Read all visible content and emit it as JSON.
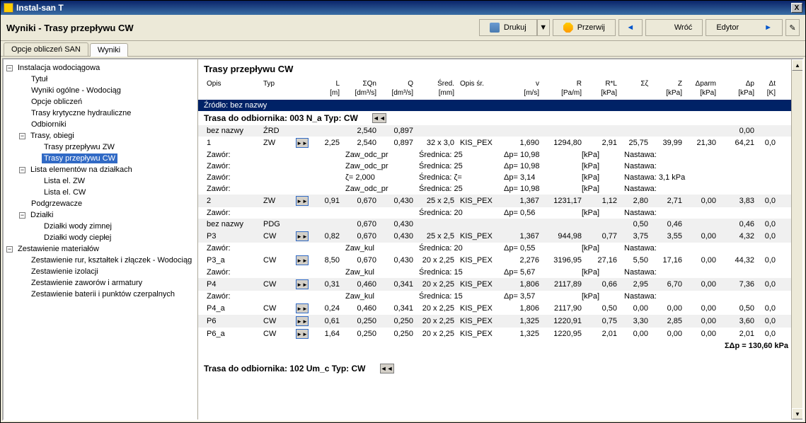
{
  "window": {
    "title": "Instal-san T",
    "close": "X"
  },
  "toolbar": {
    "page_title": "Wyniki - Trasy przepływu CW",
    "print": "Drukuj",
    "stop": "Przerwij",
    "back": "Wróć",
    "editor": "Edytor"
  },
  "tabs": {
    "tab1": "Opcje obliczeń SAN",
    "tab2": "Wyniki"
  },
  "tree": {
    "root1": "Instalacja wodociągowa",
    "n1": "Tytuł",
    "n2": "Wyniki ogólne - Wodociąg",
    "n3": "Opcje obliczeń",
    "n4": "Trasy krytyczne hydrauliczne",
    "n5": "Odbiorniki",
    "n6": "Trasy, obiegi",
    "n6a": "Trasy przepływu ZW",
    "n6b": "Trasy przepływu CW",
    "n7": "Lista elementów na działkach",
    "n7a": "Lista el. ZW",
    "n7b": "Lista el. CW",
    "n8": "Podgrzewacze",
    "n9": "Działki",
    "n9a": "Działki wody zimnej",
    "n9b": "Działki wody ciepłej",
    "root2": "Zestawienie materiałów",
    "m1": "Zestawienie rur, kształtek i złączek - Wodociąg",
    "m2": "Zestawienie izolacji",
    "m3": "Zestawienie zaworów i armatury",
    "m4": "Zestawienie baterii i punktów czerpalnych"
  },
  "panel": {
    "title": "Trasy przepływu CW",
    "headers": {
      "opis": "Opis",
      "typ": "Typ",
      "l": "L",
      "sqn": "ΣQn",
      "q": "Q",
      "sred": "Śred.",
      "opissr": "Opis śr.",
      "v": "v",
      "r": "R",
      "rl": "R*L",
      "sz": "Σζ",
      "z": "Z",
      "darm": "Δparm",
      "dp": "Δp",
      "dk": "Δt"
    },
    "units": {
      "l": "[m]",
      "sqn": "[dm³/s]",
      "q": "[dm³/s]",
      "sred": "[mm]",
      "v": "[m/s]",
      "r": "[Pa/m]",
      "rl": "[kPa]",
      "z": "[kPa]",
      "darm": "[kPa]",
      "dp": "[kPa]",
      "dk": "[K]"
    },
    "source": "Źródło: bez nazwy",
    "group1": {
      "label": "Trasa do odbiornika: 003 N_a   Typ: CW"
    },
    "group2": {
      "label": "Trasa do odbiornika: 102 Um_c   Typ: CW"
    },
    "labels": {
      "zawor": "Zawór:",
      "srednica": "Średnica:",
      "dp": "Δp=",
      "kpa": "[kPa]",
      "nastawa": "Nastawa:",
      "zeta": "ζ="
    },
    "rows": [
      {
        "opis": "bez nazwy",
        "typ": "ŹRD",
        "sqn": "2,540",
        "q": "0,897",
        "dp": "0,00",
        "dp2": "0,00"
      },
      {
        "opis": "1",
        "typ": "ZW",
        "l": "2,25",
        "sqn": "2,540",
        "q": "0,897",
        "sred": "32 x 3,0",
        "opissr": "KIS_PEX",
        "v": "1,690",
        "r": "1294,80",
        "rl": "2,91",
        "sz": "25,75",
        "z": "39,99",
        "darm": "21,30",
        "dp": "64,21",
        "dk": "0,0"
      },
      {
        "valve": true,
        "name": "Zaw_odc_pr",
        "srednica": "25",
        "dp": "10,98"
      },
      {
        "valve": true,
        "name": "Zaw_odc_pr",
        "srednica": "25",
        "dp": "10,98"
      },
      {
        "valve": true,
        "zeta": "2,000",
        "srednica": "ζ=",
        "dp": "3,14",
        "nastawa": "3,1 kPa"
      },
      {
        "valve": true,
        "name": "Zaw_odc_pr",
        "srednica": "25",
        "dp": "10,98"
      },
      {
        "opis": "2",
        "typ": "ZW",
        "l": "0,91",
        "sqn": "0,670",
        "q": "0,430",
        "sred": "25 x 2,5",
        "opissr": "KIS_PEX",
        "v": "1,367",
        "r": "1231,17",
        "rl": "1,12",
        "sz": "2,80",
        "z": "2,71",
        "darm": "0,00",
        "dp": "3,83",
        "dk": "0,0"
      },
      {
        "valve": true,
        "srednica": "20",
        "dp": "0,56"
      },
      {
        "opis": "bez nazwy",
        "typ": "PDG",
        "sqn": "0,670",
        "q": "0,430",
        "sz": "0,50",
        "z": "0,46",
        "dp": "0,46",
        "dk": "0,0"
      },
      {
        "opis": "P3",
        "typ": "CW",
        "l": "0,82",
        "sqn": "0,670",
        "q": "0,430",
        "sred": "25 x 2,5",
        "opissr": "KIS_PEX",
        "v": "1,367",
        "r": "944,98",
        "rl": "0,77",
        "sz": "3,75",
        "z": "3,55",
        "darm": "0,00",
        "dp": "4,32",
        "dk": "0,0"
      },
      {
        "valve": true,
        "name": "Zaw_kul",
        "srednica": "20",
        "dp": "0,55"
      },
      {
        "opis": "P3_a",
        "typ": "CW",
        "l": "8,50",
        "sqn": "0,670",
        "q": "0,430",
        "sred": "20 x 2,25",
        "opissr": "KIS_PEX",
        "v": "2,276",
        "r": "3196,95",
        "rl": "27,16",
        "sz": "5,50",
        "z": "17,16",
        "darm": "0,00",
        "dp": "44,32",
        "dk": "0,0"
      },
      {
        "valve": true,
        "name": "Zaw_kul",
        "srednica": "15",
        "dp": "5,67"
      },
      {
        "opis": "P4",
        "typ": "CW",
        "l": "0,31",
        "sqn": "0,460",
        "q": "0,341",
        "sred": "20 x 2,25",
        "opissr": "KIS_PEX",
        "v": "1,806",
        "r": "2117,89",
        "rl": "0,66",
        "sz": "2,95",
        "z": "6,70",
        "darm": "0,00",
        "dp": "7,36",
        "dk": "0,0"
      },
      {
        "valve": true,
        "name": "Zaw_kul",
        "srednica": "15",
        "dp": "3,57"
      },
      {
        "opis": "P4_a",
        "typ": "CW",
        "l": "0,24",
        "sqn": "0,460",
        "q": "0,341",
        "sred": "20 x 2,25",
        "opissr": "KIS_PEX",
        "v": "1,806",
        "r": "2117,90",
        "rl": "0,50",
        "sz": "0,00",
        "z": "0,00",
        "darm": "0,00",
        "dp": "0,50",
        "dk": "0,0"
      },
      {
        "opis": "P6",
        "typ": "CW",
        "l": "0,61",
        "sqn": "0,250",
        "q": "0,250",
        "sred": "20 x 2,25",
        "opissr": "KIS_PEX",
        "v": "1,325",
        "r": "1220,91",
        "rl": "0,75",
        "sz": "3,30",
        "z": "2,85",
        "darm": "0,00",
        "dp": "3,60",
        "dk": "0,0"
      },
      {
        "opis": "P6_a",
        "typ": "CW",
        "l": "1,64",
        "sqn": "0,250",
        "q": "0,250",
        "sred": "20 x 2,25",
        "opissr": "KIS_PEX",
        "v": "1,325",
        "r": "1220,95",
        "rl": "2,01",
        "sz": "0,00",
        "z": "0,00",
        "darm": "0,00",
        "dp": "2,01",
        "dk": "0,0"
      }
    ],
    "sum": "ΣΔp = 130,60 kPa"
  }
}
